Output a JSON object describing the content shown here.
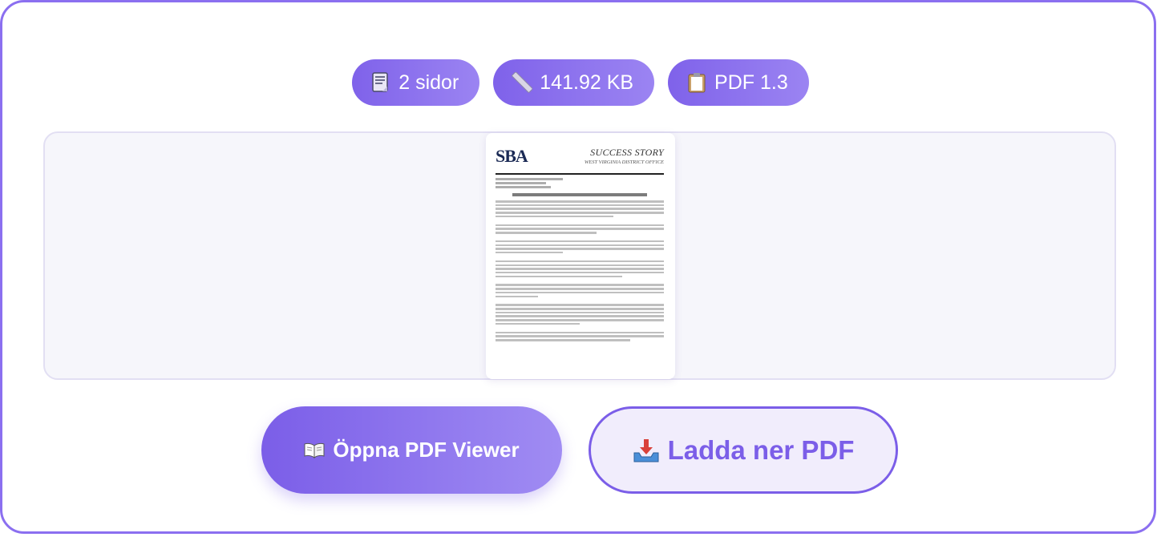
{
  "badges": [
    {
      "icon": "page-icon",
      "label": "2 sidor"
    },
    {
      "icon": "ruler-icon",
      "label": "141.92 KB"
    },
    {
      "icon": "clipboard-icon",
      "label": "PDF 1.3"
    }
  ],
  "preview": {
    "logo": "SBA",
    "title": "SUCCESS STORY",
    "subtitle": "WEST VIRGINIA DISTRICT OFFICE"
  },
  "actions": {
    "open_label": "Öppna PDF Viewer",
    "open_icon": "book-icon",
    "download_label": "Ladda ner PDF",
    "download_icon": "inbox-tray-icon"
  },
  "colors": {
    "accent": "#7b5ee8",
    "accent_light": "#a08cf3",
    "download_bg": "#f1edfc",
    "preview_bg": "#f6f6fb"
  }
}
